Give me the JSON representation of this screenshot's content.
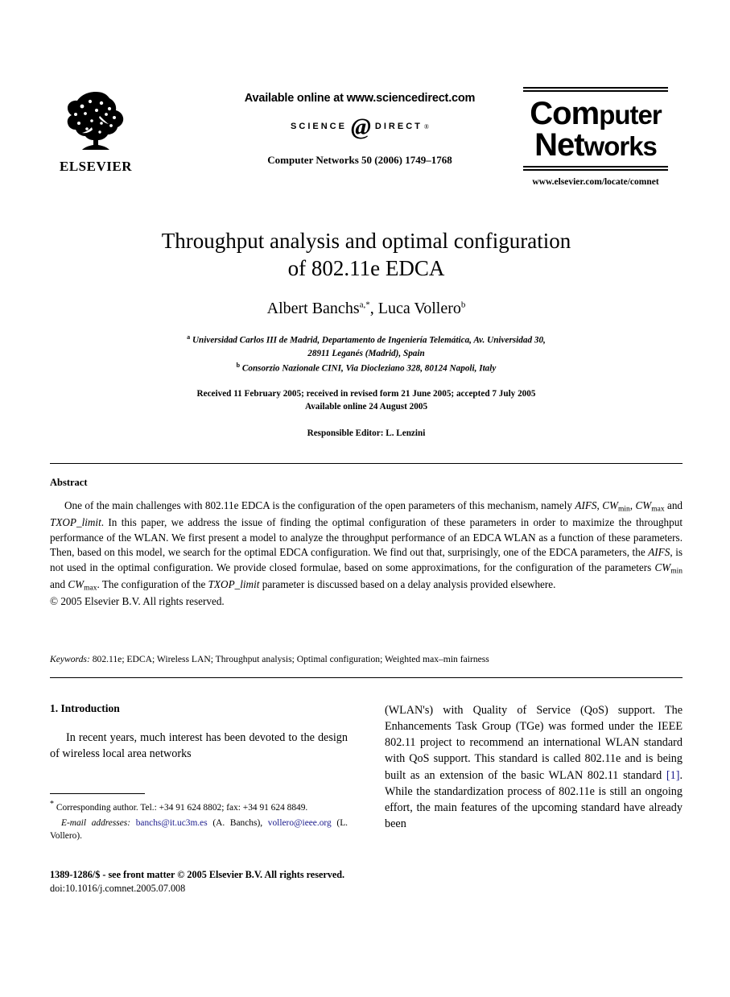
{
  "masthead": {
    "publisher_name": "ELSEVIER",
    "publisher_logo_icon": "elsevier-tree-icon",
    "available_online": "Available online at www.sciencedirect.com",
    "sciencedirect_science": "SCIENCE",
    "sciencedirect_at": "@",
    "sciencedirect_direct": "DIRECT",
    "sciencedirect_reg": "®",
    "journal_reference": "Computer Networks 50 (2006) 1749–1768",
    "journal_logo_line1": "Com",
    "journal_logo_line1b": "puter",
    "journal_logo_line2": "Net",
    "journal_logo_line2b": "works",
    "journal_url": "www.elsevier.com/locate/comnet"
  },
  "title_block": {
    "title_line1": "Throughput analysis and optimal configuration",
    "title_line2": "of 802.11e EDCA",
    "author1_name": "Albert Banchs",
    "author1_sup": "a,*",
    "authors_separator": ", ",
    "author2_name": "Luca Vollero",
    "author2_sup": "b",
    "affiliation_a_sup": "a",
    "affiliation_a_line1": "Universidad Carlos III de Madrid, Departamento de Ingeniería Telemática, Av. Universidad 30,",
    "affiliation_a_line2": "28911 Leganés (Madrid), Spain",
    "affiliation_b_sup": "b",
    "affiliation_b_line1": "Consorzio Nazionale CINI, Via Diocleziano 328, 80124 Napoli, Italy",
    "dates_line1": "Received 11 February 2005; received in revised form 21 June 2005; accepted 7 July 2005",
    "dates_line2": "Available online 24 August 2005",
    "editor": "Responsible Editor: L. Lenzini"
  },
  "abstract": {
    "heading": "Abstract",
    "paragraph_html": "One of the main challenges with 802.11e EDCA is the configuration of the open parameters of this mechanism, namely <em class=\"it\">AIFS</em>, <em class=\"it\">CW</em><sub class=\"sb\">min</sub>, <em class=\"it\">CW</em><sub class=\"sb\">max</sub> and <em class=\"it\">TXOP_limit</em>. In this paper, we address the issue of finding the optimal configuration of these parameters in order to maximize the throughput performance of the WLAN. We first present a model to analyze the throughput performance of an EDCA WLAN as a function of these parameters. Then, based on this model, we search for the optimal EDCA configuration. We find out that, surprisingly, one of the EDCA parameters, the <em class=\"it\">AIFS</em>, is not used in the optimal configuration. We provide closed formulae, based on some approximations, for the configuration of the parameters <em class=\"it\">CW</em><sub class=\"sb\">min</sub> and <em class=\"it\">CW</em><sub class=\"sb\">max</sub>. The configuration of the <em class=\"it\">TXOP_limit</em> parameter is discussed based on a delay analysis provided elsewhere.",
    "copyright": "© 2005 Elsevier B.V. All rights reserved.",
    "keywords_label": "Keywords:",
    "keywords_value": "802.11e; EDCA; Wireless LAN; Throughput analysis; Optimal configuration; Weighted max–min fairness"
  },
  "body": {
    "section_number_title": "1. Introduction",
    "left_paragraph": "In recent years, much interest has been devoted to the design of wireless local area networks",
    "right_paragraph_html": "(WLAN's) with Quality of Service (QoS) support. The Enhancements Task Group (TGe) was formed under the IEEE 802.11 project to recommend an international WLAN standard with QoS support. This standard is called 802.11e and is being built as an extension of the basic WLAN 802.11 standard <a class=\"link\" href=\"#\">[1]</a>. While the standardization process of 802.11e is still an ongoing effort, the main features of the upcoming standard have already been"
  },
  "footnote": {
    "marker": "*",
    "corresponding_html": "<sup>*</sup> Corresponding author. Tel.: +34 91 624 8802; fax: +34 91 624 8849.",
    "email_label": "E-mail addresses:",
    "email_html": "<em class=\"it\">E-mail addresses:</em> <a class=\"link\" href=\"#\">banchs@it.uc3m.es</a> (A. Banchs), <a class=\"link\" href=\"#\">vollero@ieee.org</a> (L. Vollero)."
  },
  "page_footer": {
    "front_matter": "1389-1286/$ - see front matter © 2005 Elsevier B.V. All rights reserved.",
    "doi": "doi:10.1016/j.comnet.2005.07.008"
  },
  "colors": {
    "link": "#1a1a8c",
    "text": "#000000",
    "background": "#ffffff"
  }
}
